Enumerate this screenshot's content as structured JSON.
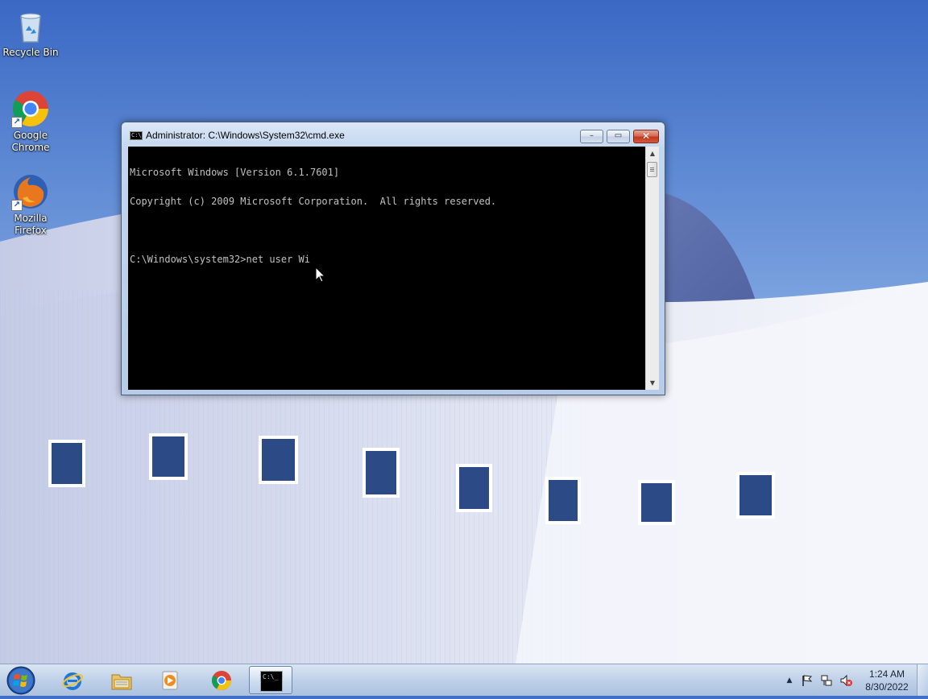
{
  "desktop": {
    "icons": [
      {
        "label": "Recycle Bin",
        "icon": "recycle-bin-icon"
      },
      {
        "label": "Google Chrome",
        "icon": "chrome-icon"
      },
      {
        "label": "Mozilla Firefox",
        "icon": "firefox-icon"
      }
    ]
  },
  "window": {
    "title": "Administrator: C:\\Windows\\System32\\cmd.exe",
    "icon_text": "C:\\",
    "controls": {
      "minimize": "–",
      "maximize": "▭",
      "close": "✕"
    },
    "console_lines": [
      "Microsoft Windows [Version 6.1.7601]",
      "Copyright (c) 2009 Microsoft Corporation.  All rights reserved.",
      "",
      "C:\\Windows\\system32>net user Wi"
    ],
    "scrollbar": {
      "up": "▲",
      "down": "▼"
    }
  },
  "taskbar": {
    "pinned": [
      {
        "name": "internet-explorer-icon"
      },
      {
        "name": "windows-explorer-icon"
      },
      {
        "name": "media-player-icon"
      },
      {
        "name": "chrome-icon"
      },
      {
        "name": "cmd-icon",
        "active": true,
        "icon_text": "C:\\_"
      }
    ],
    "tray": {
      "show_hidden": "▲",
      "time": "1:24 AM",
      "date": "8/30/2022"
    }
  },
  "colors": {
    "console_bg": "#000000",
    "console_fg": "#c0c0c0",
    "close_button": "#c1391f",
    "sky": "#4a78cc"
  }
}
